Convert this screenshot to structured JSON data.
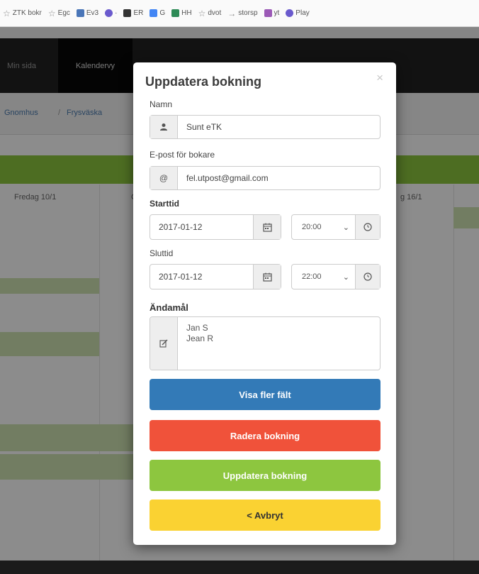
{
  "colors": {
    "primary_button": "#337ab7",
    "danger_button": "#f0523a",
    "success_button": "#8dc63f",
    "warning_button": "#fad232",
    "navbar": "#222222",
    "calendar_bar": "#8cc63e"
  },
  "bookmarks": [
    {
      "label": "ZTK bokr",
      "icon": "star-icon",
      "color": "#888888"
    },
    {
      "label": "Egc",
      "icon": "star-icon",
      "color": "#888888"
    },
    {
      "label": "Ev3",
      "icon": "folder-icon",
      "color": "#4a76b8"
    },
    {
      "label": "·",
      "icon": "globe-icon",
      "color": "#6a5acd"
    },
    {
      "label": "ER",
      "icon": "square-icon",
      "color": "#333333"
    },
    {
      "label": "G",
      "icon": "square-icon",
      "color": "#4285f4"
    },
    {
      "label": "HH",
      "icon": "square-icon",
      "color": "#2e8b57"
    },
    {
      "label": "dvot",
      "icon": "star-icon",
      "color": "#888888"
    },
    {
      "label": "storsp",
      "icon": "arrow-icon",
      "color": "#888888"
    },
    {
      "label": "yt",
      "icon": "square-icon",
      "color": "#9b59b6"
    },
    {
      "label": "Play",
      "icon": "globe-icon",
      "color": "#6a5acd"
    }
  ],
  "navbar": {
    "items": [
      "Min sida",
      "Kalendervy"
    ]
  },
  "breadcrumb": [
    "Gnomhus",
    "Frysväska"
  ],
  "calendar": {
    "day_headers": [
      "Fredag 10/1",
      "C",
      "g 16/1"
    ]
  },
  "modal": {
    "title": "Uppdatera bokning",
    "close_symbol": "×",
    "name_label": "Namn",
    "name_value": "Sunt eTK",
    "email_label": "E-post för bokare",
    "email_value": "fel.utpost@gmail.com",
    "start_label": "Starttid",
    "start_date": "2017-01-12",
    "start_time": "20:00",
    "end_label": "Sluttid",
    "end_date": "2017-01-12",
    "end_time": "22:00",
    "purpose_label": "Ändamål",
    "purpose_value": "Jan S\nJean R",
    "buttons": {
      "more_fields": "Visa fler fält",
      "delete": "Radera bokning",
      "update": "Uppdatera bokning",
      "cancel": "< Avbryt"
    }
  }
}
